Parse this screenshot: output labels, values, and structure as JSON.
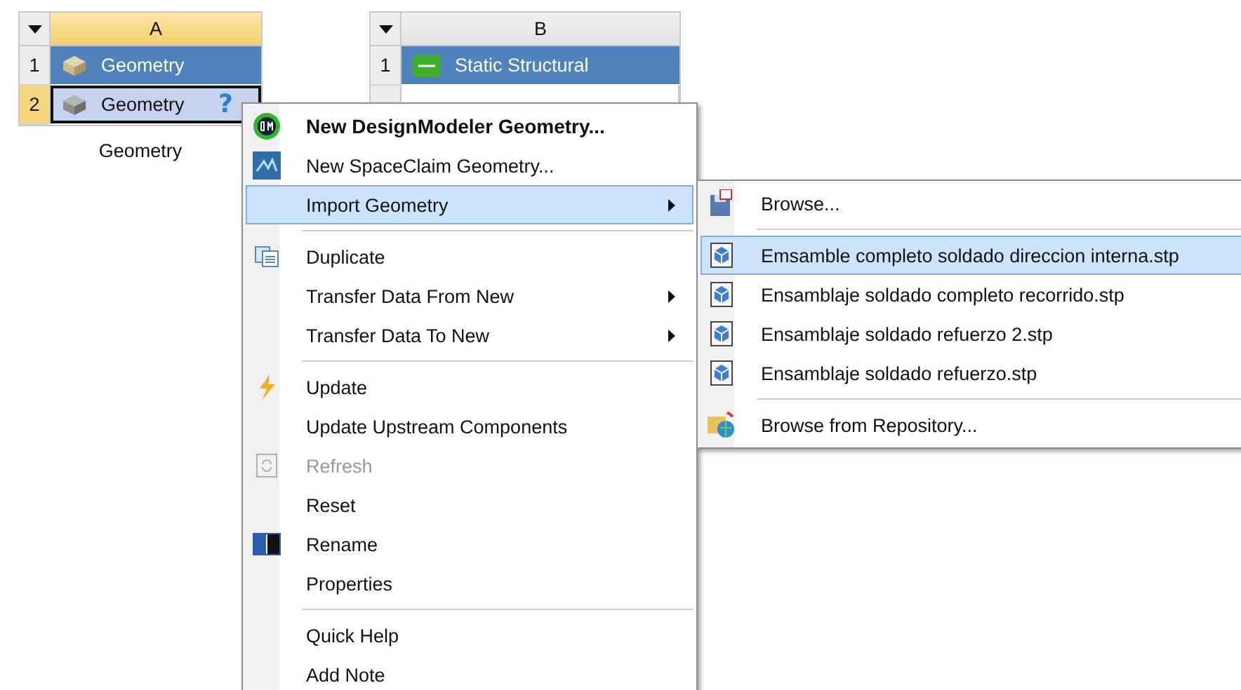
{
  "systems": [
    {
      "column": "A",
      "caption": "Geometry",
      "rows": [
        {
          "number": "1",
          "label": "Geometry",
          "kind": "title",
          "selected": false
        },
        {
          "number": "2",
          "label": "Geometry",
          "kind": "cell",
          "selected": true,
          "badge": "?"
        }
      ]
    },
    {
      "column": "B",
      "rows": [
        {
          "number": "1",
          "label": "Static Structural",
          "kind": "title",
          "selected": false
        }
      ]
    }
  ],
  "context_menu": [
    {
      "kind": "item",
      "label": "New DesignModeler Geometry...",
      "bold": true,
      "disabled": false,
      "submenu": false,
      "selected": false
    },
    {
      "kind": "item",
      "label": "New SpaceClaim Geometry...",
      "bold": false,
      "disabled": false,
      "submenu": false,
      "selected": false
    },
    {
      "kind": "item",
      "label": "Import Geometry",
      "bold": false,
      "disabled": false,
      "submenu": true,
      "selected": true
    },
    {
      "kind": "separator"
    },
    {
      "kind": "item",
      "label": "Duplicate",
      "bold": false,
      "disabled": false,
      "submenu": false,
      "selected": false
    },
    {
      "kind": "item",
      "label": "Transfer Data From New",
      "bold": false,
      "disabled": false,
      "submenu": true,
      "selected": false
    },
    {
      "kind": "item",
      "label": "Transfer Data To New",
      "bold": false,
      "disabled": false,
      "submenu": true,
      "selected": false
    },
    {
      "kind": "separator"
    },
    {
      "kind": "item",
      "label": "Update",
      "bold": false,
      "disabled": false,
      "submenu": false,
      "selected": false
    },
    {
      "kind": "item",
      "label": "Update Upstream Components",
      "bold": false,
      "disabled": false,
      "submenu": false,
      "selected": false
    },
    {
      "kind": "item",
      "label": "Refresh",
      "bold": false,
      "disabled": true,
      "submenu": false,
      "selected": false
    },
    {
      "kind": "item",
      "label": "Reset",
      "bold": false,
      "disabled": false,
      "submenu": false,
      "selected": false
    },
    {
      "kind": "item",
      "label": "Rename",
      "bold": false,
      "disabled": false,
      "submenu": false,
      "selected": false
    },
    {
      "kind": "item",
      "label": "Properties",
      "bold": false,
      "disabled": false,
      "submenu": false,
      "selected": false
    },
    {
      "kind": "separator"
    },
    {
      "kind": "item",
      "label": "Quick Help",
      "bold": false,
      "disabled": false,
      "submenu": false,
      "selected": false
    },
    {
      "kind": "item",
      "label": "Add Note",
      "bold": false,
      "disabled": false,
      "submenu": false,
      "selected": false
    }
  ],
  "submenu": [
    {
      "kind": "item",
      "label": "Browse...",
      "selected": false
    },
    {
      "kind": "separator"
    },
    {
      "kind": "item",
      "label": "Emsamble completo soldado direccion interna.stp",
      "selected": true
    },
    {
      "kind": "item",
      "label": "Ensamblaje soldado completo recorrido.stp",
      "selected": false
    },
    {
      "kind": "item",
      "label": "Ensamblaje soldado refuerzo 2.stp",
      "selected": false
    },
    {
      "kind": "item",
      "label": "Ensamblaje soldado refuerzo.stp",
      "selected": false
    },
    {
      "kind": "separator"
    },
    {
      "kind": "item",
      "label": "Browse from Repository...",
      "selected": false
    }
  ]
}
